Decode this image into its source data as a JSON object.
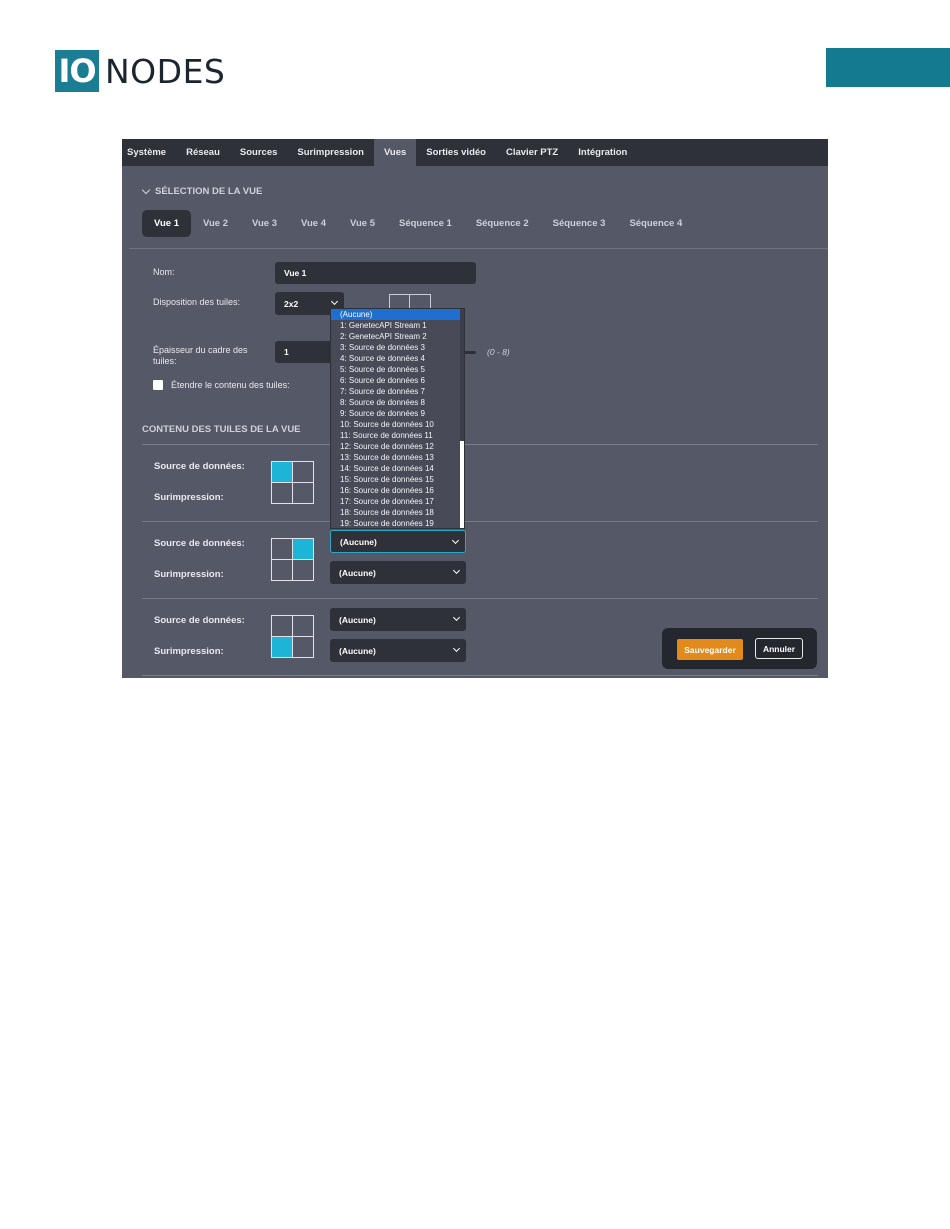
{
  "doc_header": {
    "logo_io": "IO",
    "logo_nodes": "NODES",
    "accent_color": "#1a7d93"
  },
  "nav": {
    "items": [
      "Système",
      "Réseau",
      "Sources",
      "Surimpression",
      "Vues",
      "Sorties vidéo",
      "Clavier PTZ",
      "Intégration"
    ],
    "active": "Vues"
  },
  "view_selection": {
    "heading": "SÉLECTION DE LA VUE",
    "tabs": [
      "Vue 1",
      "Vue 2",
      "Vue 3",
      "Vue 4",
      "Vue 5",
      "Séquence 1",
      "Séquence 2",
      "Séquence 3",
      "Séquence 4"
    ],
    "active_tab": "Vue 1"
  },
  "form": {
    "name_label": "Nom:",
    "name_value": "Vue 1",
    "layout_label": "Disposition des tuiles:",
    "layout_value": "2x2",
    "border_label_line1": "Épaisseur du cadre des",
    "border_label_line2": "tuiles:",
    "border_value": "1",
    "border_range": "(0 - 8)",
    "stretch_label": "Étendre le contenu des tuiles:",
    "stretch_checked": false
  },
  "tiles_content": {
    "heading": "CONTENU DES TUILES DE LA VUE",
    "source_label": "Source de données:",
    "overlay_label": "Surimpression:",
    "rows": [
      {
        "selected_cell": 0,
        "source": "(Aucune)",
        "overlay": "(Aucune)"
      },
      {
        "selected_cell": 1,
        "source": "(Aucune)",
        "overlay": "(Aucune)"
      },
      {
        "selected_cell": 2,
        "source": "(Aucune)",
        "overlay": "(Aucune)"
      }
    ],
    "highlight_color": "#1eb4d8"
  },
  "dropdown": {
    "options": [
      "(Aucune)",
      "1: GenetecAPI Stream 1",
      "2: GenetecAPI Stream 2",
      "3: Source de données 3",
      "4: Source de données 4",
      "5: Source de données 5",
      "6: Source de données 6",
      "7: Source de données 7",
      "8: Source de données 8",
      "9: Source de données 9",
      "10: Source de données 10",
      "11: Source de données 11",
      "12: Source de données 12",
      "13: Source de données 13",
      "14: Source de données 14",
      "15: Source de données 15",
      "16: Source de données 16",
      "17: Source de données 17",
      "18: Source de données 18",
      "19: Source de données 19"
    ],
    "highlighted": "(Aucune)"
  },
  "actions": {
    "save_label": "Sauvegarder",
    "cancel_label": "Annuler",
    "save_color": "#e38a1c"
  }
}
